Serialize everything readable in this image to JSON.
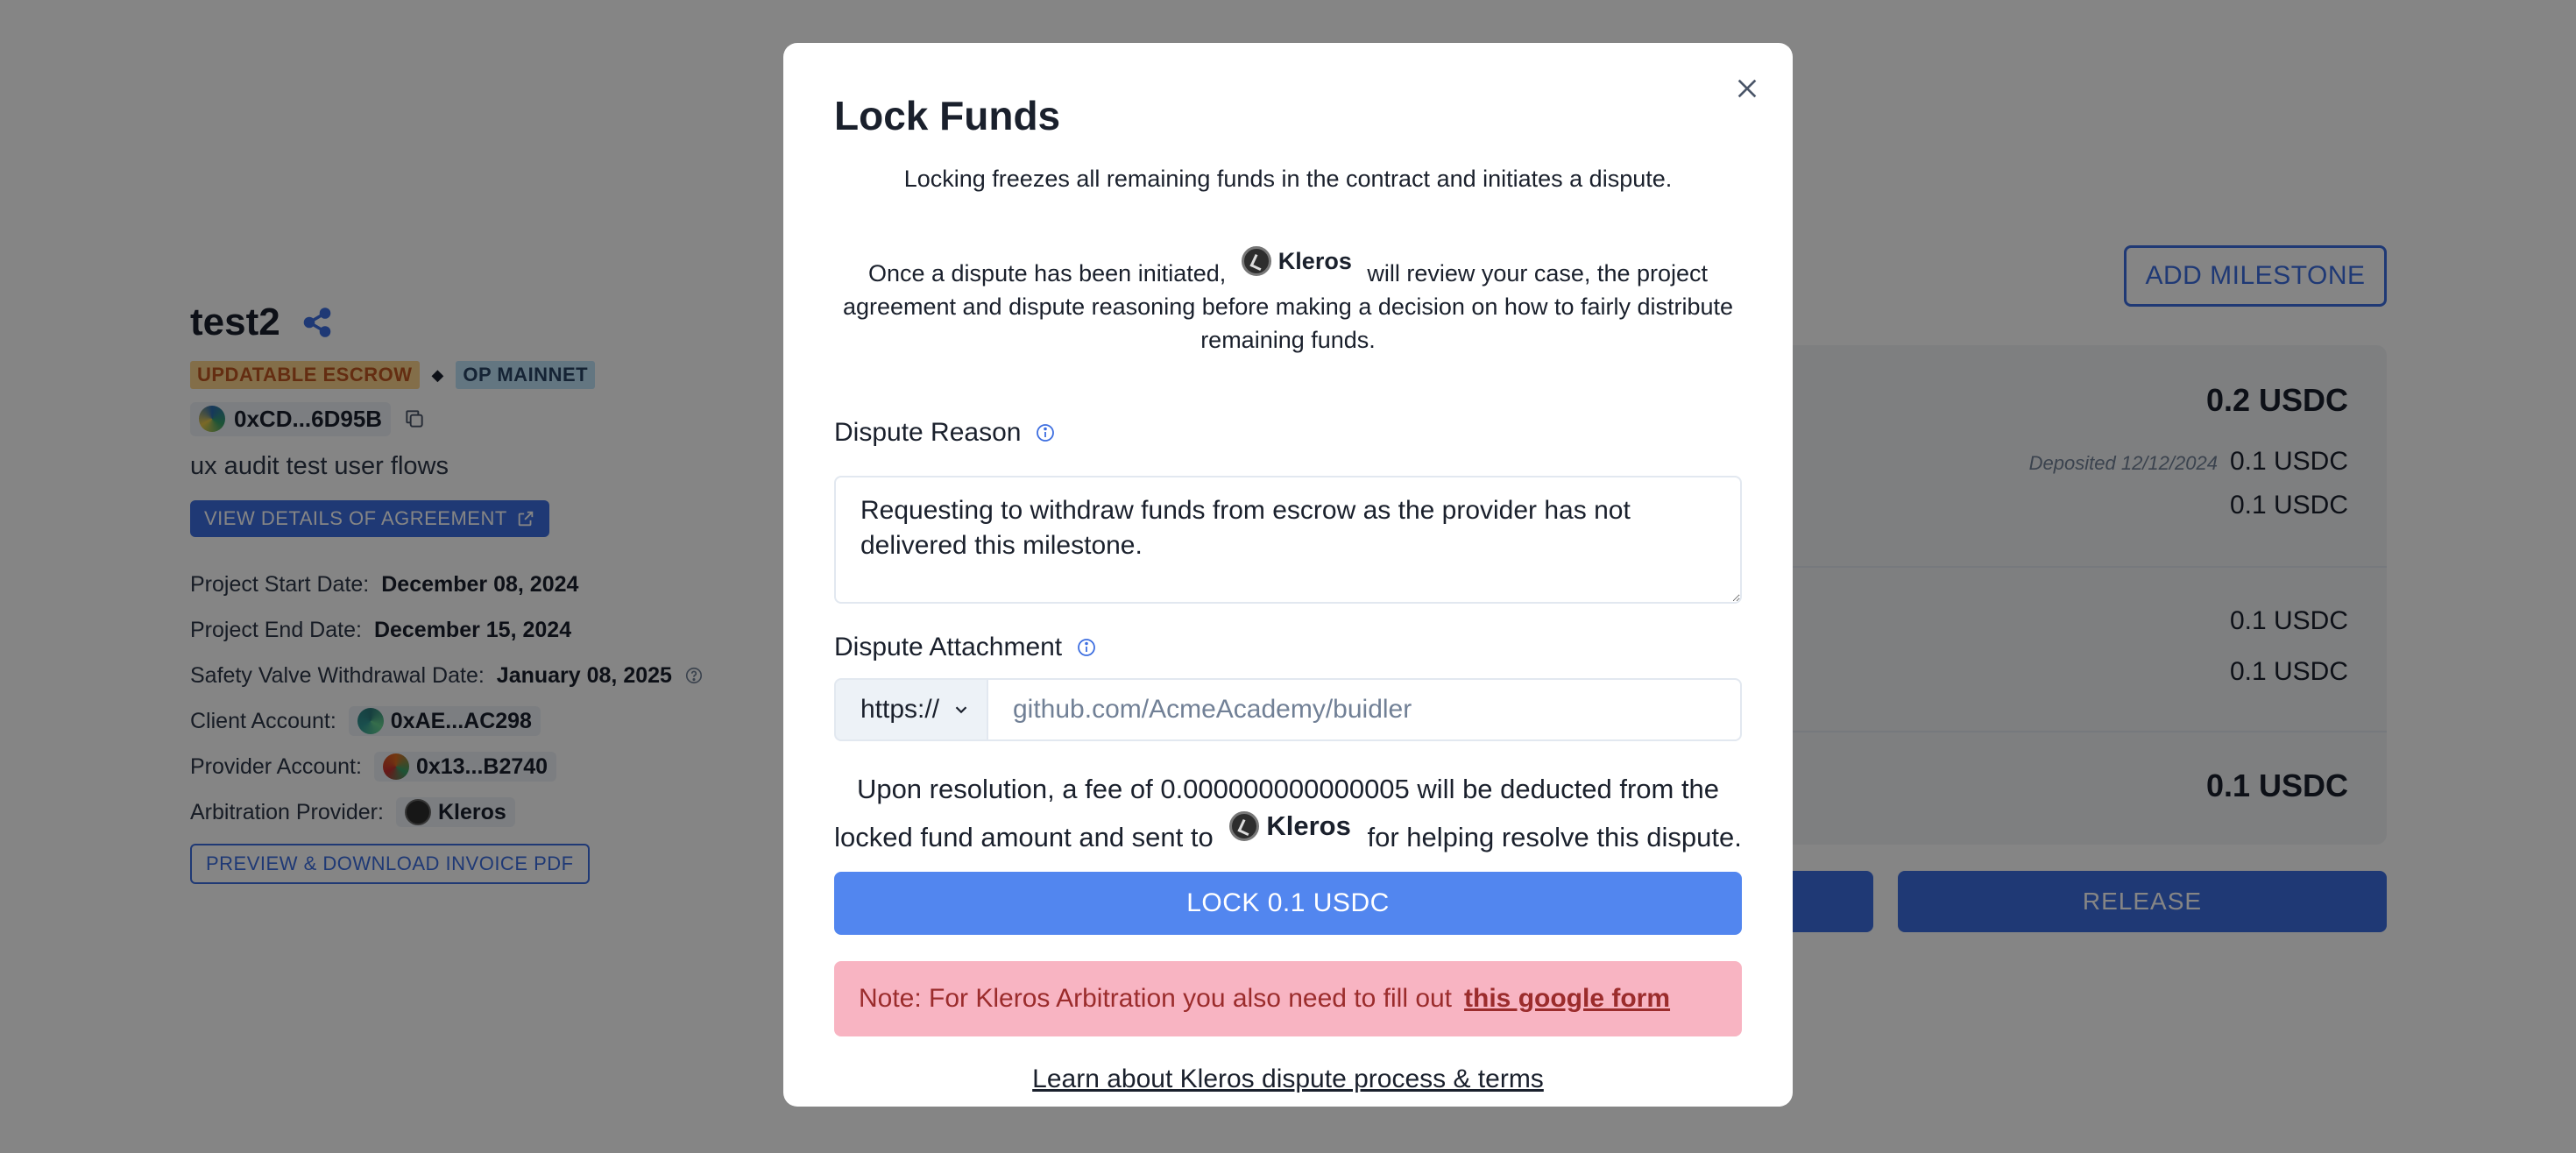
{
  "project": {
    "title": "test2",
    "tags": {
      "escrow": "UPDATABLE ESCROW",
      "separator": "◆",
      "network": "OP MAINNET"
    },
    "address": "0xCD...6D95B",
    "description": "ux audit test user flows",
    "view_agreement_label": "VIEW DETAILS OF AGREEMENT",
    "info": {
      "start_label": "Project Start Date:",
      "start_value": "December 08, 2024",
      "end_label": "Project End Date:",
      "end_value": "December 15, 2024",
      "safety_label": "Safety Valve Withdrawal Date:",
      "safety_value": "January 08, 2025",
      "client_label": "Client Account:",
      "client_value": "0xAE...AC298",
      "provider_label": "Provider Account:",
      "provider_value": "0x13...B2740",
      "arbitration_label": "Arbitration Provider:",
      "arbitration_value": "Kleros"
    },
    "invoice_label": "PREVIEW & DOWNLOAD INVOICE PDF"
  },
  "milestones": {
    "add_label": "ADD MILESTONE",
    "total": "0.2 USDC",
    "deposited_label": "Deposited 12/12/2024",
    "deposited_value": "0.1 USDC",
    "line2": "0.1 USDC",
    "line3": "0.1 USDC",
    "line4": "0.1 USDC",
    "remaining": "0.1 USDC",
    "release_label": "RELEASE"
  },
  "modal": {
    "title": "Lock Funds",
    "subtitle": "Locking freezes all remaining funds in the contract and initiates a dispute.",
    "desc_pre": "Once a dispute has been initiated,",
    "kleros": "Kleros",
    "desc_post": "will review your case, the project agreement and dispute reasoning before making a decision on how to fairly distribute remaining funds.",
    "reason_label": "Dispute Reason",
    "reason_value": "Requesting to withdraw funds from escrow as the provider has not delivered this milestone.",
    "attachment_label": "Dispute Attachment",
    "protocol": "https://",
    "url_placeholder": "github.com/AcmeAcademy/buidler",
    "fee_pre": "Upon resolution, a fee of 0.000000000000005 will be deducted from the locked fund amount and sent to",
    "fee_post": "for helping resolve this dispute.",
    "lock_button": "LOCK 0.1 USDC",
    "note_text": "Note: For Kleros Arbitration you also need to fill out",
    "note_link": "this google form",
    "learn_link": "Learn about Kleros dispute process & terms"
  }
}
